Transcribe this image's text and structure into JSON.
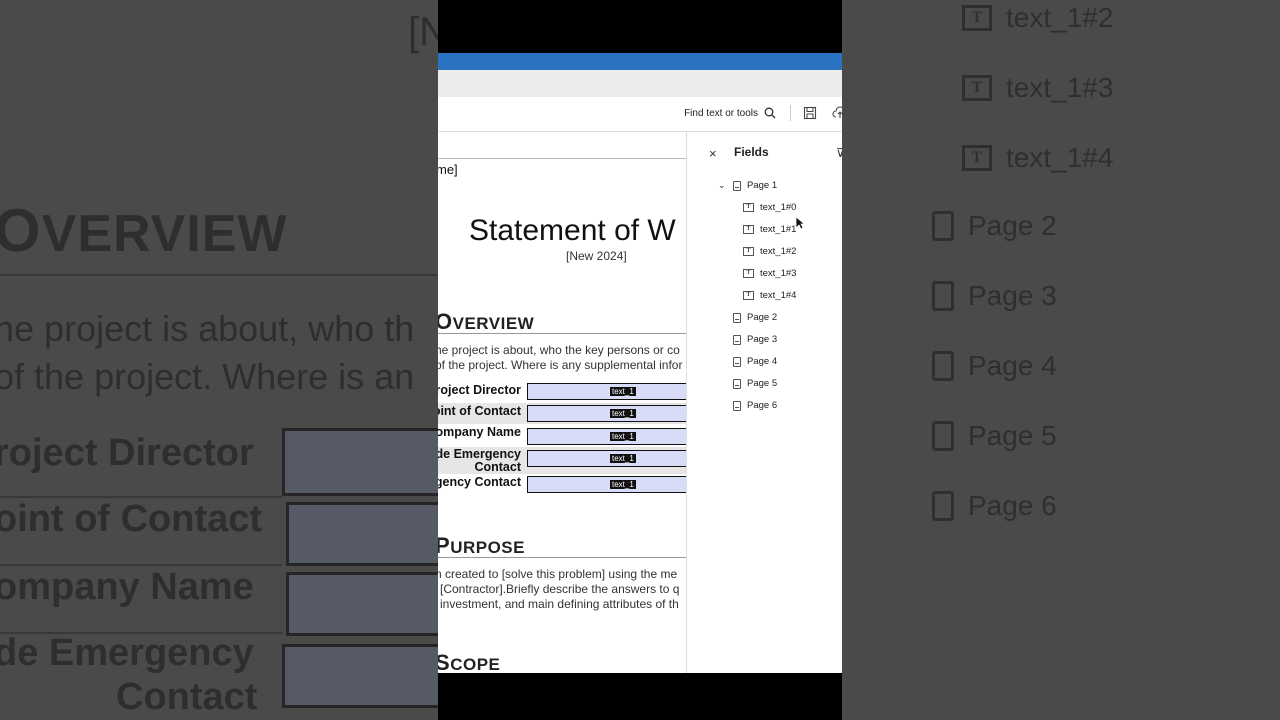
{
  "background_left": {
    "bracket_text": "[N",
    "heading": "Overview",
    "paragraph_line1": "he project is about, who th",
    "paragraph_line2": "of the project. Where is an",
    "rows": [
      "roject Director",
      "oint of Contact",
      "ompany Name",
      "de Emergency",
      "Contact"
    ]
  },
  "background_right": {
    "fields": [
      "text_1#2",
      "text_1#3",
      "text_1#4"
    ],
    "pages": [
      "Page 2",
      "Page 3",
      "Page 4",
      "Page 5",
      "Page 6"
    ]
  },
  "toolbar": {
    "find_label": "Find text or tools"
  },
  "document": {
    "name_fragment": "me]",
    "title": "Statement of W",
    "subtitle": "[New 2024]",
    "overview_heading_first": "O",
    "overview_heading_rest": "VERVIEW",
    "overview_line1": "he project is about, who the key persons or co",
    "overview_line2": "of the project. Where is any supplemental infor",
    "form_rows": [
      {
        "label": "Project Director",
        "field": "text_1"
      },
      {
        "label": "oint of Contact",
        "field": "text_1"
      },
      {
        "label": "ompany Name",
        "field": "text_1"
      },
      {
        "label": "de Emergency",
        "label2": "Contact",
        "field": "text_1"
      },
      {
        "label": "gency Contact",
        "field": "text_1"
      }
    ],
    "purpose_heading_first": "P",
    "purpose_heading_rest": "URPOSE",
    "purpose_line1": "n created to [solve this problem] using the me",
    "purpose_line2": "[Contractor].Briefly describe the answers to q",
    "purpose_line3": "investment, and main defining attributes of th",
    "scope_heading_first": "S",
    "scope_heading_rest": "COPE"
  },
  "fields_panel": {
    "title": "Fields",
    "close_label": "×",
    "page1": "Page 1",
    "fields": [
      "text_1#0",
      "text_1#1",
      "text_1#2",
      "text_1#3",
      "text_1#4"
    ],
    "pages": [
      "Page 2",
      "Page 3",
      "Page 4",
      "Page 5",
      "Page 6"
    ]
  }
}
